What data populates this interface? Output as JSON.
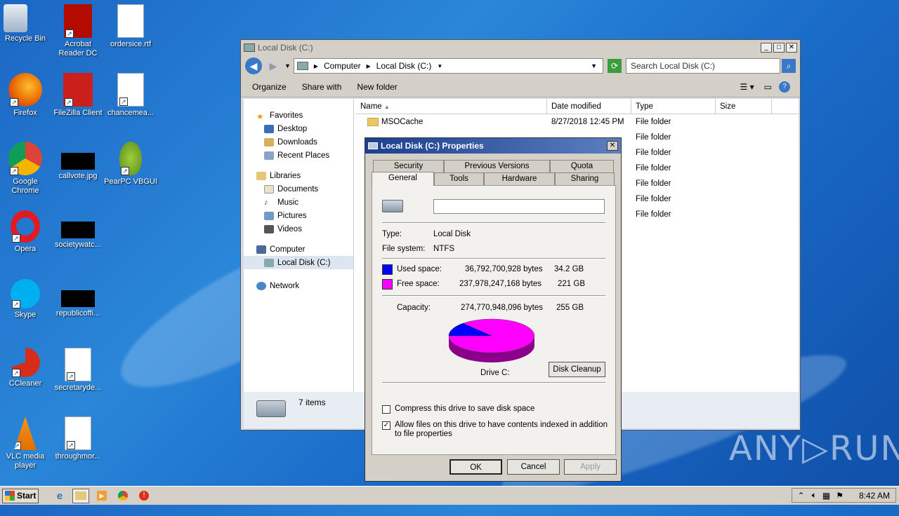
{
  "desktop": {
    "icons": [
      {
        "label": "Recycle Bin",
        "icon": "recycle-bin-icon"
      },
      {
        "label": "Acrobat Reader DC",
        "icon": "acrobat-icon"
      },
      {
        "label": "ordersice.rtf",
        "icon": "word-doc-icon"
      },
      {
        "label": "Firefox",
        "icon": "firefox-icon"
      },
      {
        "label": "FileZilla Client",
        "icon": "filezilla-icon"
      },
      {
        "label": "chancemea...",
        "icon": "word-doc-icon"
      },
      {
        "label": "Google Chrome",
        "icon": "chrome-icon"
      },
      {
        "label": "callvote.jpg",
        "icon": "image-file-icon"
      },
      {
        "label": "PearPC VBGUI",
        "icon": "pear-icon"
      },
      {
        "label": "Opera",
        "icon": "opera-icon"
      },
      {
        "label": "societywatc...",
        "icon": "image-file-icon"
      },
      {
        "label": "Skype",
        "icon": "skype-icon"
      },
      {
        "label": "republicoffi...",
        "icon": "image-file-icon"
      },
      {
        "label": "CCleaner",
        "icon": "ccleaner-icon"
      },
      {
        "label": "secretaryde...",
        "icon": "word-doc-icon"
      },
      {
        "label": "VLC media player",
        "icon": "vlc-icon"
      },
      {
        "label": "throughmor...",
        "icon": "word-doc-icon"
      }
    ]
  },
  "explorer": {
    "title": "Local Disk (C:)",
    "breadcrumb": [
      "Computer",
      "Local Disk (C:)"
    ],
    "search_placeholder": "Search Local Disk (C:)",
    "toolbar": {
      "organize": "Organize",
      "share": "Share with",
      "new_folder": "New folder"
    },
    "nav": {
      "favorites": "Favorites",
      "desktop": "Desktop",
      "downloads": "Downloads",
      "recent": "Recent Places",
      "libraries": "Libraries",
      "documents": "Documents",
      "music": "Music",
      "pictures": "Pictures",
      "videos": "Videos",
      "computer": "Computer",
      "local_disk": "Local Disk (C:)",
      "network": "Network"
    },
    "columns": {
      "name": "Name",
      "date": "Date modified",
      "type": "Type",
      "size": "Size"
    },
    "first_row": {
      "name": "MSOCache",
      "date": "8/27/2018 12:45 PM"
    },
    "file_type": "File folder",
    "status": "7 items"
  },
  "dialog": {
    "title": "Local Disk (C:) Properties",
    "tabs_row1": [
      "Security",
      "Previous Versions",
      "Quota"
    ],
    "tabs_row2": [
      "General",
      "Tools",
      "Hardware",
      "Sharing"
    ],
    "volume_label_value": "",
    "type_label": "Type:",
    "type_value": "Local Disk",
    "fs_label": "File system:",
    "fs_value": "NTFS",
    "used_label": "Used space:",
    "used_bytes": "36,792,700,928 bytes",
    "used_gb": "34.2 GB",
    "free_label": "Free space:",
    "free_bytes": "237,978,247,168 bytes",
    "free_gb": "221 GB",
    "cap_label": "Capacity:",
    "cap_bytes": "274,770,948,096 bytes",
    "cap_gb": "255 GB",
    "drive_label": "Drive C:",
    "cleanup_button": "Disk Cleanup",
    "compress_label": "Compress this drive to save disk space",
    "index_label": "Allow files on this drive to have contents indexed in addition to file properties",
    "ok": "OK",
    "cancel": "Cancel",
    "apply": "Apply",
    "used_fraction": 0.1339,
    "colors": {
      "used": "#0000ff",
      "free": "#ff00ff"
    }
  },
  "taskbar": {
    "start": "Start",
    "clock": "8:42 AM"
  },
  "watermark": "ANY▷RUN"
}
